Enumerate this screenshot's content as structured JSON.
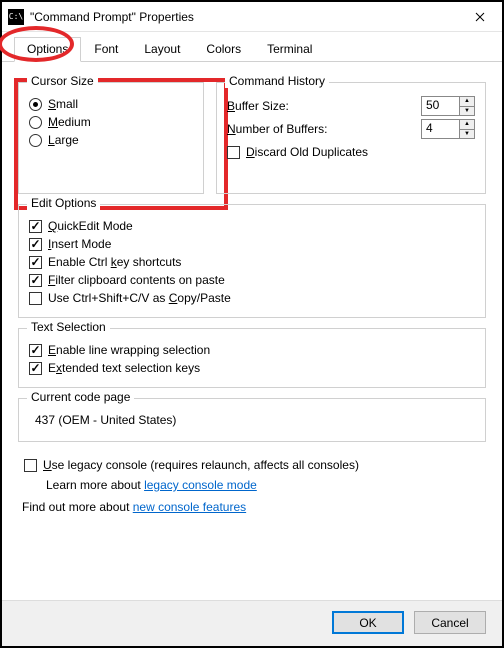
{
  "window": {
    "title": "\"Command Prompt\" Properties",
    "icon_text": "C:\\"
  },
  "tabs": {
    "options": "Options",
    "font": "Font",
    "layout": "Layout",
    "colors": "Colors",
    "terminal": "Terminal",
    "active": "options"
  },
  "cursor_size": {
    "legend": "Cursor Size",
    "small": "Small",
    "medium": "Medium",
    "large": "Large",
    "selected": "small"
  },
  "command_history": {
    "legend": "Command History",
    "buffer_size_label": "Buffer Size:",
    "buffer_size_value": "50",
    "num_buffers_label": "Number of Buffers:",
    "num_buffers_value": "4",
    "discard_label": "Discard Old Duplicates",
    "discard_checked": false
  },
  "edit_options": {
    "legend": "Edit Options",
    "quickedit": "QuickEdit Mode",
    "quickedit_checked": true,
    "insert": "Insert Mode",
    "insert_checked": true,
    "ctrlkeys": "Enable Ctrl key shortcuts",
    "ctrlkeys_checked": true,
    "filter": "Filter clipboard contents on paste",
    "filter_checked": true,
    "ctrlshift": "Use Ctrl+Shift+C/V as Copy/Paste",
    "ctrlshift_checked": false
  },
  "text_selection": {
    "legend": "Text Selection",
    "wrap": "Enable line wrapping selection",
    "wrap_checked": true,
    "extended": "Extended text selection keys",
    "extended_checked": true
  },
  "code_page": {
    "legend": "Current code page",
    "value": "437   (OEM - United States)"
  },
  "legacy": {
    "label": "Use legacy console (requires relaunch, affects all consoles)",
    "checked": false,
    "learn_prefix": "Learn more about ",
    "learn_link": "legacy console mode"
  },
  "findmore": {
    "prefix": "Find out more about ",
    "link": "new console features"
  },
  "buttons": {
    "ok": "OK",
    "cancel": "Cancel"
  }
}
